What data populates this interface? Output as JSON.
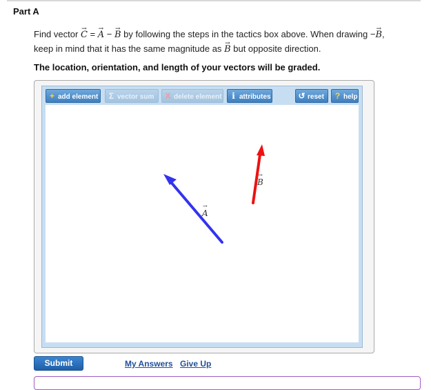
{
  "part": {
    "title": "Part A"
  },
  "question": {
    "find_text": "Find vector",
    "vec_c": "C",
    "eq": "=",
    "vec_a": "A",
    "minus": "−",
    "vec_b": "B",
    "steps_text": "by following the steps in the tactics box above. When drawing",
    "neg_sign": "−",
    "vec_b2": "B",
    "comma": ",",
    "line2_text": "keep in mind that it has the same magnitude as",
    "vec_b3": "B",
    "line2_end": "but opposite direction.",
    "arrow_glyph": "→"
  },
  "grade_note": "The location, orientation, and length of your vectors will be graded.",
  "toolbar": {
    "add_element": "add element",
    "vector_sum": "vector sum",
    "delete_element": "delete element",
    "attributes": "attributes",
    "reset": "reset",
    "help": "help"
  },
  "icons": {
    "add": "+",
    "sum": "Σ",
    "delete": "X",
    "info": "i",
    "reset": "↺",
    "help": "?"
  },
  "canvas": {
    "vectors": [
      {
        "label": "A",
        "color": "#3333ee"
      },
      {
        "label": "B",
        "color": "#ee1111"
      }
    ]
  },
  "actions": {
    "submit": "Submit",
    "my_answers": "My Answers",
    "give_up": "Give Up"
  },
  "colors": {
    "accent": "#1f5fa8",
    "vector_a": "#3333ee",
    "vector_b": "#ee1111",
    "frame": "#c7def2"
  }
}
